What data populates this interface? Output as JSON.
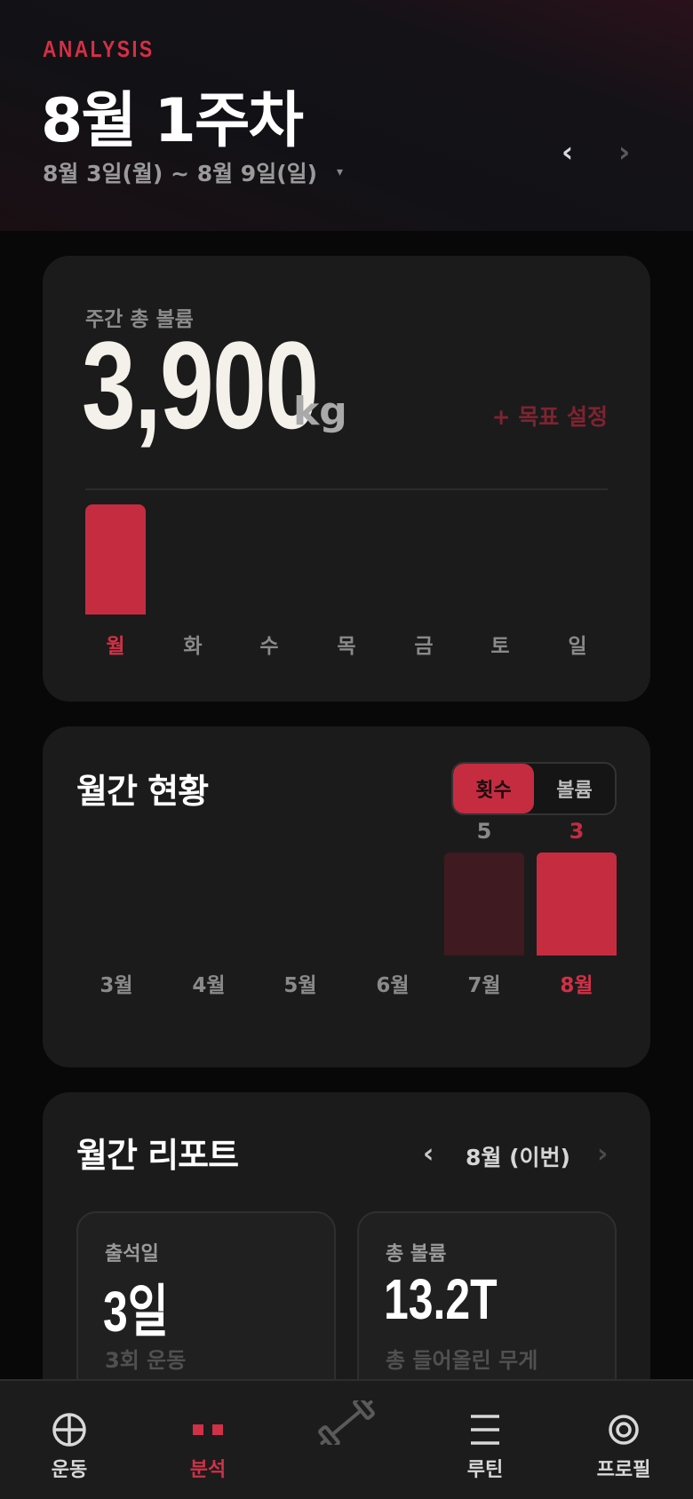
{
  "header": {
    "eyebrow": "ANALYSIS",
    "title": "8월 1주차",
    "range": "8월 3일(월) ~ 8월 9일(일)",
    "caret": "▾",
    "prev": "‹",
    "next": "›"
  },
  "weekly": {
    "label": "주간 총 볼륨",
    "value": "3,900",
    "unit": "kg",
    "goal": "+ 목표 설정",
    "chart_data": {
      "type": "bar",
      "categories": [
        "월",
        "화",
        "수",
        "목",
        "금",
        "토",
        "일"
      ],
      "values": [
        3900,
        0,
        0,
        0,
        0,
        0,
        0
      ],
      "ylim": [
        0,
        3900
      ],
      "active_index": 0,
      "color": "#c52c40"
    }
  },
  "monthly": {
    "title": "월간 현황",
    "toggle": {
      "count": "횟수",
      "volume": "볼륨",
      "selected": "count"
    },
    "chart_data": {
      "type": "bar",
      "categories": [
        "3월",
        "4월",
        "5월",
        "6월",
        "7월",
        "8월"
      ],
      "values": [
        0,
        0,
        0,
        0,
        5,
        3
      ],
      "labels": [
        "",
        "",
        "",
        "",
        "5",
        "3"
      ],
      "active_index": 5,
      "color_active": "#c52c40",
      "color_inactive": "#3f1a20"
    }
  },
  "report": {
    "title": "월간 리포트",
    "month": "8월 (이번)",
    "prev": "‹",
    "next": "›",
    "stats": [
      {
        "label": "출석일",
        "value": "3일",
        "sub": "3회 운동"
      },
      {
        "label": "총 볼륨",
        "value": "13.2T",
        "sub": "총 들어올린 무게"
      }
    ]
  },
  "tabs": [
    {
      "label": "운동",
      "icon": "target-icon"
    },
    {
      "label": "분석",
      "icon": "analysis-icon",
      "active": true
    },
    {
      "label": "",
      "icon": "dumbbell-icon"
    },
    {
      "label": "루틴",
      "icon": "menu-icon"
    },
    {
      "label": "프로필",
      "icon": "profile-icon"
    }
  ],
  "colors": {
    "accent": "#c52c40",
    "background": "#080808",
    "card": "#1b1b1c"
  }
}
